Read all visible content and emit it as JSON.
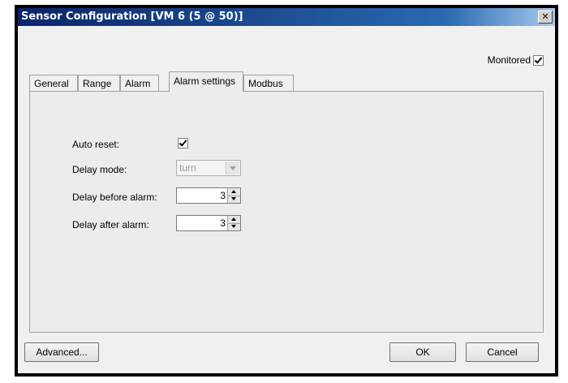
{
  "window": {
    "title": "Sensor Configuration [VM 6 (5 @ 50)]",
    "close_symbol": "✕"
  },
  "monitored": {
    "label": "Monitored",
    "checked": true
  },
  "tabs": [
    {
      "label": "General",
      "active": false
    },
    {
      "label": "Range",
      "active": false
    },
    {
      "label": "Alarm",
      "active": false
    },
    {
      "label": "Alarm settings",
      "active": true
    },
    {
      "label": "Modbus",
      "active": false
    }
  ],
  "form": {
    "auto_reset": {
      "label": "Auto reset:",
      "checked": true
    },
    "delay_mode": {
      "label": "Delay mode:",
      "value": "turn",
      "enabled": false
    },
    "delay_before": {
      "label": "Delay before alarm:",
      "value": "3"
    },
    "delay_after": {
      "label": "Delay after alarm:",
      "value": "3"
    }
  },
  "buttons": {
    "advanced": "Advanced...",
    "ok": "OK",
    "cancel": "Cancel"
  }
}
